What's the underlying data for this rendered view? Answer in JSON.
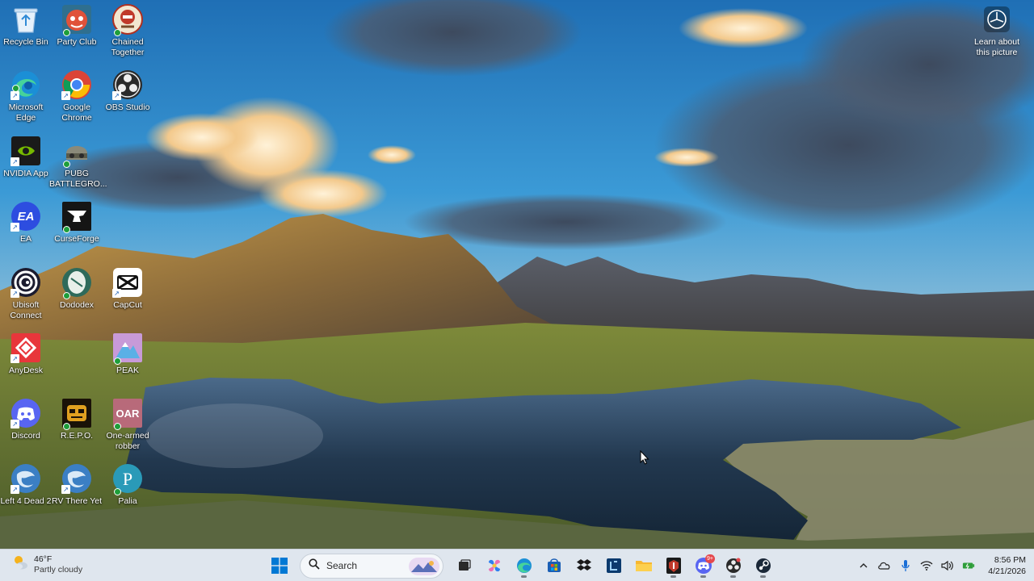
{
  "desktop": {
    "icons": [
      {
        "label": "Recycle Bin",
        "icon": "recycle-bin-icon"
      },
      {
        "label": "Party Club",
        "icon": "party-club-icon"
      },
      {
        "label": "Chained Together",
        "icon": "chained-together-icon"
      },
      {
        "label": "Microsoft Edge",
        "icon": "edge-icon"
      },
      {
        "label": "Google Chrome",
        "icon": "chrome-icon"
      },
      {
        "label": "OBS Studio",
        "icon": "obs-icon"
      },
      {
        "label": "NVIDIA App",
        "icon": "nvidia-icon"
      },
      {
        "label": "PUBG BATTLEGRO...",
        "icon": "pubg-icon"
      },
      {
        "label": "EA",
        "icon": "ea-icon"
      },
      {
        "label": "CurseForge",
        "icon": "curseforge-icon"
      },
      {
        "label": "Ubisoft Connect",
        "icon": "ubisoft-icon"
      },
      {
        "label": "Dododex",
        "icon": "dododex-icon"
      },
      {
        "label": "CapCut",
        "icon": "capcut-icon"
      },
      {
        "label": "AnyDesk",
        "icon": "anydesk-icon"
      },
      {
        "label": "PEAK",
        "icon": "peak-icon"
      },
      {
        "label": "Discord",
        "icon": "discord-icon"
      },
      {
        "label": "R.E.P.O.",
        "icon": "repo-icon"
      },
      {
        "label": "One-armed robber",
        "icon": "one-armed-robber-icon"
      },
      {
        "label": "Left 4 Dead 2",
        "icon": "left4dead2-icon"
      },
      {
        "label": "RV There Yet",
        "icon": "rv-there-yet-icon"
      },
      {
        "label": "Palia",
        "icon": "palia-icon"
      }
    ],
    "learn_about": "Learn about this picture"
  },
  "taskbar": {
    "weather": {
      "temp": "46°F",
      "condition": "Partly cloudy"
    },
    "search_placeholder": "Search",
    "apps": [
      {
        "name": "start",
        "icon": "windows-start-icon"
      },
      {
        "name": "task-view",
        "icon": "task-view-icon"
      },
      {
        "name": "copilot",
        "icon": "copilot-icon"
      },
      {
        "name": "edge",
        "icon": "edge-icon"
      },
      {
        "name": "store",
        "icon": "store-icon"
      },
      {
        "name": "dropbox",
        "icon": "dropbox-icon"
      },
      {
        "name": "app-blue",
        "icon": "app-blue-icon"
      },
      {
        "name": "file-explorer",
        "icon": "folder-icon"
      },
      {
        "name": "game",
        "icon": "game-icon"
      },
      {
        "name": "discord",
        "icon": "discord-icon"
      },
      {
        "name": "obs",
        "icon": "obs-icon"
      },
      {
        "name": "steam",
        "icon": "steam-icon"
      }
    ],
    "discord_badge": "9+",
    "clock": {
      "time": "8:56 PM",
      "date": "4/21/2026"
    }
  },
  "colors": {
    "taskbar_bg": "#dfe6ee",
    "accent": "#0078d4"
  }
}
